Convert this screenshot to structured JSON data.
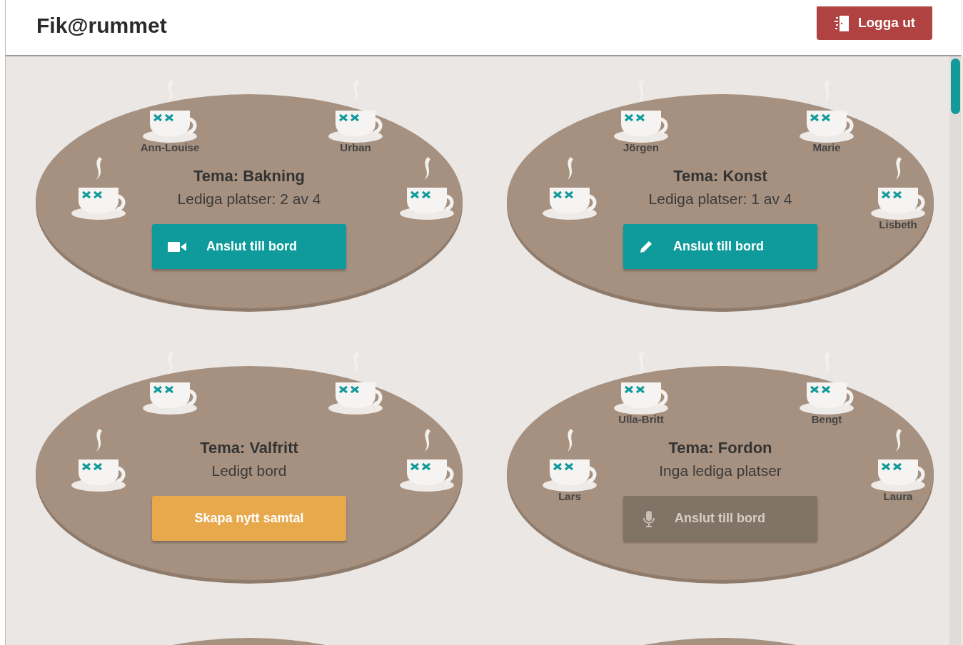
{
  "header": {
    "title": "Fik@rummet",
    "logout": "Logga ut"
  },
  "tables": [
    {
      "kind": "full",
      "theme": "Tema: Bakning",
      "status": "Lediga platser: 2 av 4",
      "guests": {
        "top_left": "Ann-Louise",
        "top_right": "Urban"
      },
      "button": {
        "label": "Anslut till bord",
        "kind": "video",
        "disabled": false
      }
    },
    {
      "kind": "full",
      "theme": "Tema: Konst",
      "status": "Lediga platser: 1 av 4",
      "guests": {
        "top_left": "Jörgen",
        "top_right": "Marie",
        "right": "Lisbeth"
      },
      "button": {
        "label": "Anslut till bord",
        "kind": "chat",
        "disabled": false
      }
    },
    {
      "kind": "full",
      "theme": "Tema: Valfritt",
      "status": "Ledigt bord",
      "button": {
        "label": "Skapa nytt samtal",
        "kind": "create",
        "disabled": false
      }
    },
    {
      "kind": "full",
      "theme": "Tema: Fordon",
      "status": "Inga lediga platser",
      "guests": {
        "top_left": "Ulla-Britt",
        "top_right": "Bengt",
        "left": "Lars",
        "right": "Laura"
      },
      "button": {
        "label": "Anslut till bord",
        "kind": "voice",
        "disabled": true
      }
    },
    {
      "kind": "partial"
    },
    {
      "kind": "partial"
    }
  ]
}
